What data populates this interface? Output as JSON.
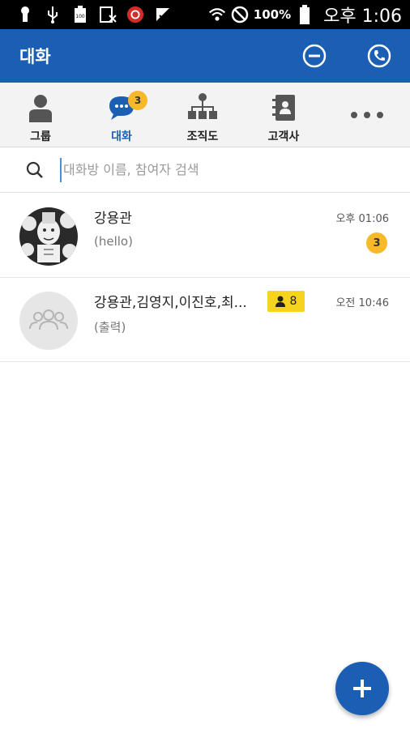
{
  "status_bar": {
    "battery": "100%",
    "time": "오후 1:06",
    "icons": [
      "keyhole-icon",
      "usb-icon",
      "battery-100-icon",
      "rx-icon",
      "app-icon",
      "check-icon",
      "wifi-icon",
      "mute-icon",
      "battery-icon"
    ]
  },
  "app_bar": {
    "title": "대화",
    "actions": [
      "minus-circle-icon",
      "phone-circle-icon"
    ]
  },
  "tabs": [
    {
      "label": "그룹",
      "icon": "person-icon"
    },
    {
      "label": "대화",
      "icon": "chat-bubble-icon",
      "badge": "3",
      "active": true
    },
    {
      "label": "조직도",
      "icon": "org-chart-icon"
    },
    {
      "label": "고객사",
      "icon": "contacts-book-icon"
    }
  ],
  "more": "more-icon",
  "search": {
    "placeholder": "대화방 이름, 참여자 검색",
    "value": ""
  },
  "chats": [
    {
      "name": "강용관",
      "message": "(hello)",
      "time": "오후 01:06",
      "unread": "3"
    },
    {
      "name": "강용관,김영지,이진호,최...",
      "message": "(출력)",
      "time": "오전 10:46",
      "members": "8"
    }
  ],
  "colors": {
    "primary": "#1a5fb4",
    "badge": "#f5b92b",
    "member_badge": "#f5d31f",
    "tab_bg": "#f3f3f3"
  }
}
